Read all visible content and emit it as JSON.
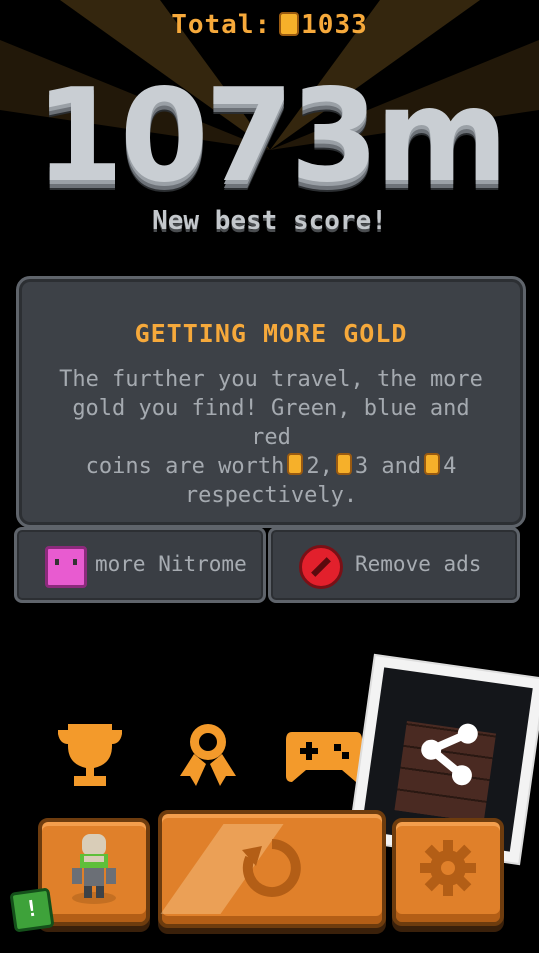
{
  "header": {
    "total_label": "Total:",
    "total_value": "1033",
    "distance": "1073m",
    "best_score": "New best score!"
  },
  "tip_panel": {
    "title": "GETTING MORE GOLD",
    "line1": "The further you travel, the more",
    "line2": "gold you find! Green, blue and red",
    "line3_a": "coins are worth",
    "line3_b": "2,",
    "line3_c": "3 and",
    "line3_d": "4",
    "line4": "respectively."
  },
  "buttons": {
    "more_nitrome": "more Nitrome",
    "remove_ads": "Remove ads"
  },
  "icons": {
    "trophy": "trophy-icon",
    "award": "award-ribbon-icon",
    "gamepad": "gamepad-icon",
    "share": "share-icon",
    "replay": "replay-icon",
    "settings": "gear-icon",
    "character": "character-avatar",
    "alert": "!"
  },
  "colors": {
    "accent": "#f6a93b",
    "button_orange": "#e0802a",
    "panel": "#3d4147",
    "gold": "#f6b02a",
    "remove_ads_red": "#e2202c",
    "nitrome_pink": "#e85bd0"
  }
}
